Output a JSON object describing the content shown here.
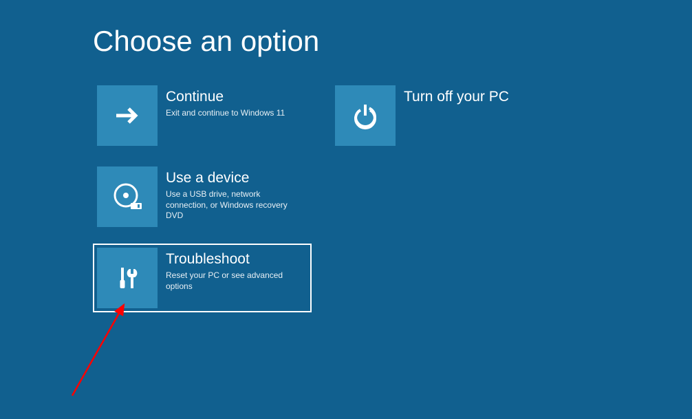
{
  "title": "Choose an option",
  "tiles": {
    "continue": {
      "title": "Continue",
      "desc": "Exit and continue to Windows 11"
    },
    "use_device": {
      "title": "Use a device",
      "desc": "Use a USB drive, network connection, or Windows recovery DVD"
    },
    "troubleshoot": {
      "title": "Troubleshoot",
      "desc": "Reset your PC or see advanced options"
    },
    "turn_off": {
      "title": "Turn off your PC",
      "desc": ""
    }
  }
}
